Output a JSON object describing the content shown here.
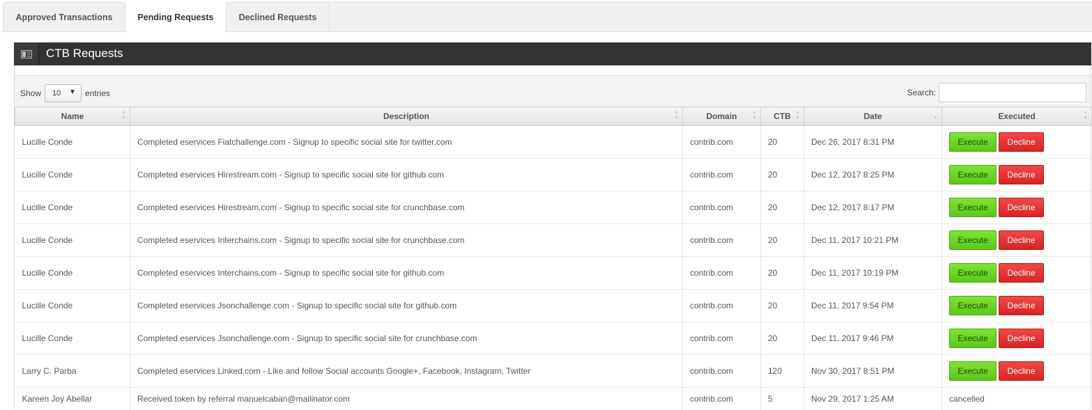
{
  "tabs": [
    {
      "label": "Approved Transactions"
    },
    {
      "label": "Pending Requests"
    },
    {
      "label": "Declined Requests"
    }
  ],
  "widget": {
    "title": "CTB Requests",
    "icon": "list-icon"
  },
  "controls": {
    "show_label": "Show",
    "entries_value": "10",
    "entries_label": "entries",
    "search_label": "Search:",
    "search_value": ""
  },
  "table": {
    "headers": [
      "Name",
      "Description",
      "Domain",
      "CTB",
      "Date",
      "Executed"
    ],
    "rows": [
      {
        "name": "Lucille Conde",
        "description": "Completed eservices Fiatchallenge.com - Signup to specific social site for twitter.com",
        "domain": "contrib.com",
        "ctb": "20",
        "date": "Dec 26, 2017 8:31 PM",
        "executed": ""
      },
      {
        "name": "Lucille Conde",
        "description": "Completed eservices Hirestream.com - Signup to specific social site for github.com",
        "domain": "contrib.com",
        "ctb": "20",
        "date": "Dec 12, 2017 8:25 PM",
        "executed": ""
      },
      {
        "name": "Lucille Conde",
        "description": "Completed eservices Hirestream.com - Signup to specific social site for crunchbase.com",
        "domain": "contrib.com",
        "ctb": "20",
        "date": "Dec 12, 2017 8:17 PM",
        "executed": ""
      },
      {
        "name": "Lucille Conde",
        "description": "Completed eservices Interchains.com - Signup to specific social site for crunchbase.com",
        "domain": "contrib.com",
        "ctb": "20",
        "date": "Dec 11, 2017 10:21 PM",
        "executed": ""
      },
      {
        "name": "Lucille Conde",
        "description": "Completed eservices Interchains.com - Signup to specific social site for github.com",
        "domain": "contrib.com",
        "ctb": "20",
        "date": "Dec 11, 2017 10:19 PM",
        "executed": ""
      },
      {
        "name": "Lucille Conde",
        "description": "Completed eservices Jsonchallenge.com - Signup to specific social site for github.com",
        "domain": "contrib.com",
        "ctb": "20",
        "date": "Dec 11, 2017 9:54 PM",
        "executed": ""
      },
      {
        "name": "Lucille Conde",
        "description": "Completed eservices Jsonchallenge.com - Signup to specific social site for crunchbase.com",
        "domain": "contrib.com",
        "ctb": "20",
        "date": "Dec 11, 2017 9:46 PM",
        "executed": ""
      },
      {
        "name": "Larry C. Parba",
        "description": "Completed eservices Linked.com - Like and follow Social accounts Google+, Facebook, Instagram, Twitter",
        "domain": "contrib.com",
        "ctb": "120",
        "date": "Nov 30, 2017 8:51 PM",
        "executed": ""
      },
      {
        "name": "Kareen Joy Abellar",
        "description": "Received token by referral manuelcaban@mailinator.com",
        "domain": "contrib.com",
        "ctb": "5",
        "date": "Nov 29, 2017 1:25 AM",
        "executed": "cancelled"
      }
    ],
    "buttons": {
      "execute": "Execute",
      "decline": "Decline"
    }
  },
  "colors": {
    "header_bg": "#333333",
    "execute": "#68d526",
    "decline": "#e53333"
  }
}
